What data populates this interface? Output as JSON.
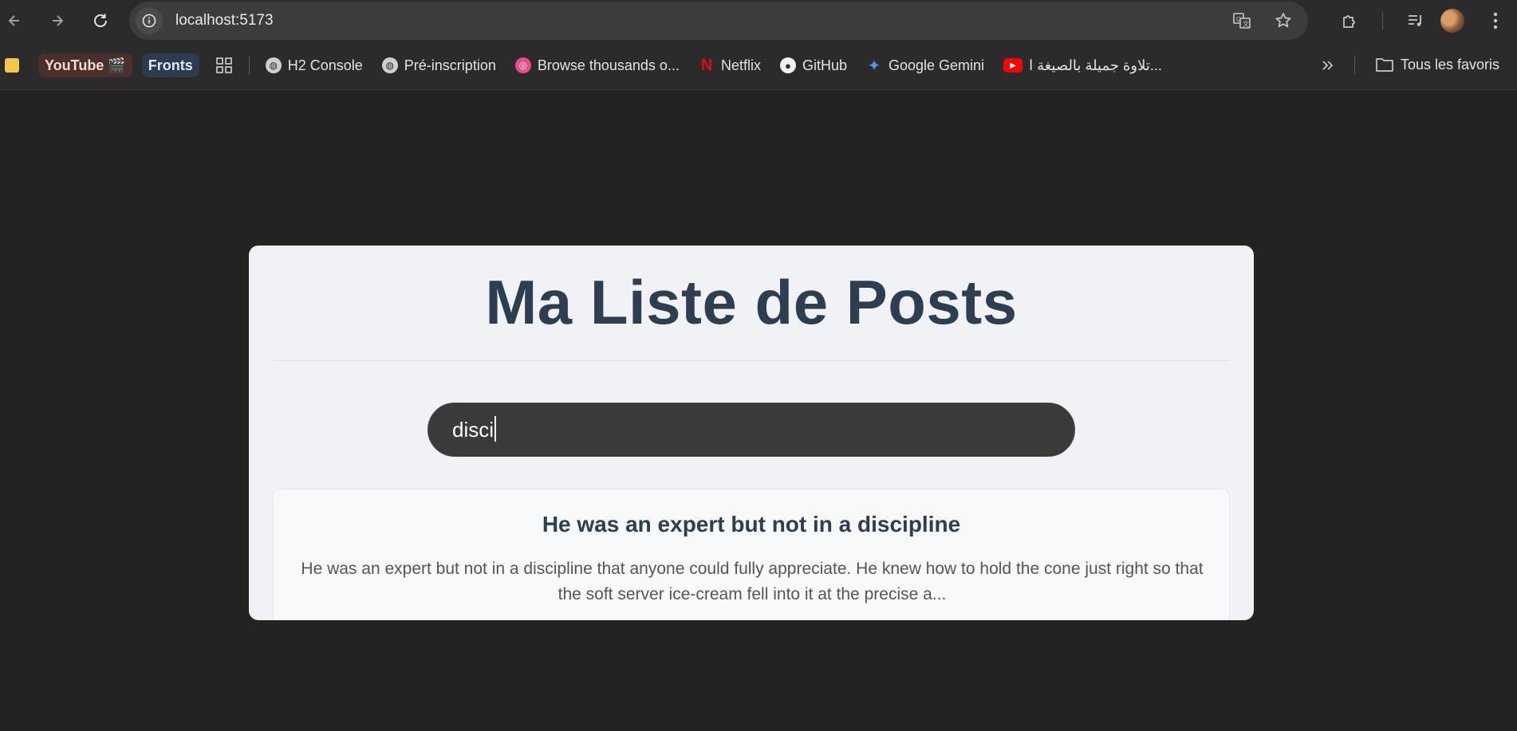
{
  "browser": {
    "url": "localhost:5173",
    "bookmarks": [
      {
        "label": "YouTube 🎬",
        "style": "chip-red"
      },
      {
        "label": "Fronts",
        "style": "chip-blue"
      },
      {
        "label": "H2 Console",
        "icon": "globe-icon"
      },
      {
        "label": "Pré-inscription",
        "icon": "globe-icon"
      },
      {
        "label": "Browse thousands o...",
        "icon": "dribbble-icon"
      },
      {
        "label": "Netflix",
        "icon": "netflix-icon"
      },
      {
        "label": "GitHub",
        "icon": "github-icon"
      },
      {
        "label": "Google Gemini",
        "icon": "gemini-icon"
      },
      {
        "label": "تلاوة جميلة بالصيغة ا...",
        "icon": "youtube-icon"
      }
    ],
    "all_bookmarks_label": "Tous les favoris"
  },
  "app": {
    "title": "Ma Liste de Posts",
    "search": {
      "value": "disci"
    },
    "posts": [
      {
        "title": "He was an expert but not in a discipline",
        "body": "He was an expert but not in a discipline that anyone could fully appreciate. He knew how to hold the cone just right so that the soft server ice-cream fell into it at the precise a..."
      }
    ]
  },
  "colors": {
    "page_bg": "#232323",
    "card_bg": "#f0f2f6",
    "title": "#2c3e50",
    "search_bg": "#3a3a3a"
  }
}
